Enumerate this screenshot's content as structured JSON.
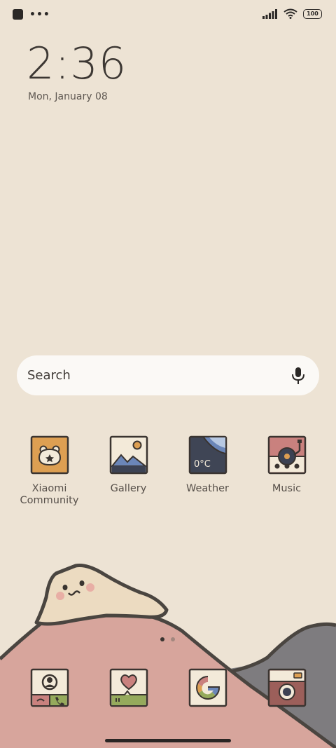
{
  "status_bar": {
    "left_icons": [
      "notification-square-icon",
      "more-dots-icon"
    ],
    "right_icons": [
      "signal-icon",
      "wifi-icon",
      "battery-icon"
    ],
    "battery_level": "100"
  },
  "clock": {
    "time": "2:36",
    "date": "Mon, January 08"
  },
  "search": {
    "placeholder": "Search",
    "icon": "microphone-icon"
  },
  "apps": [
    {
      "label": "Xiaomi\nCommunity",
      "icon": "xiaomi-community-icon"
    },
    {
      "label": "Gallery",
      "icon": "gallery-icon"
    },
    {
      "label": "Weather",
      "icon": "weather-icon",
      "badge": "0°C"
    },
    {
      "label": "Music",
      "icon": "music-icon"
    }
  ],
  "page_indicator": {
    "pages": 2,
    "current": 1
  },
  "dock": [
    {
      "icon": "phone-icon"
    },
    {
      "icon": "messages-icon"
    },
    {
      "icon": "google-icon"
    },
    {
      "icon": "camera-icon"
    }
  ],
  "colors": {
    "background": "#ede3d4",
    "mountain_pink": "#d7a59c",
    "mountain_gray": "#7e7c7f",
    "outline": "#4a4540"
  }
}
